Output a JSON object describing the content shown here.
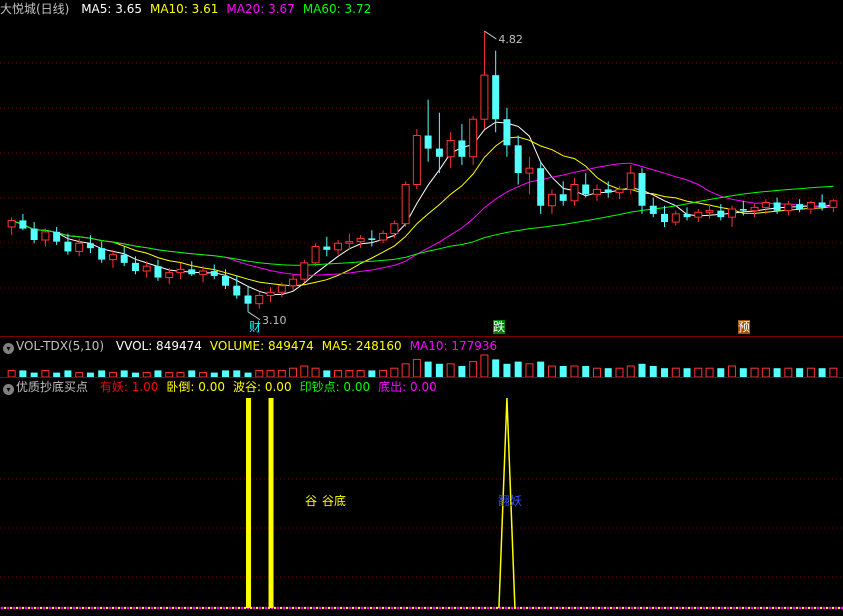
{
  "main": {
    "title": "大悦城(日线)",
    "ma": [
      {
        "label": "MA5:",
        "value": "3.65",
        "color": "#ffffff"
      },
      {
        "label": "MA10:",
        "value": "3.61",
        "color": "#ffff00"
      },
      {
        "label": "MA20:",
        "value": "3.67",
        "color": "#ff00ff"
      },
      {
        "label": "MA60:",
        "value": "3.72",
        "color": "#00ff00"
      }
    ],
    "high_label": "4.82",
    "low_label": "3.10",
    "markers": [
      {
        "text": "财",
        "color": "#00ffff",
        "bg": "#202080"
      },
      {
        "text": "跌",
        "color": "#ffffff",
        "bg": "#008000"
      },
      {
        "text": "预",
        "color": "#ffffff",
        "bg": "#a05000"
      }
    ]
  },
  "volume": {
    "title": "VOL-TDX(5,10)",
    "items": [
      {
        "label": "VVOL:",
        "value": "849474",
        "color": "#ffffff"
      },
      {
        "label": "VOLUME:",
        "value": "849474",
        "color": "#ffff00"
      },
      {
        "label": "MA5:",
        "value": "248160",
        "color": "#ffff00"
      },
      {
        "label": "MA10:",
        "value": "177936",
        "color": "#ff00ff"
      }
    ]
  },
  "indicator": {
    "title": "优质抄底买点",
    "items": [
      {
        "label": "有妖:",
        "value": "1.00",
        "color": "#ff0000"
      },
      {
        "label": "卧倒:",
        "value": "0.00",
        "color": "#ffff00"
      },
      {
        "label": "波谷:",
        "value": "0.00",
        "color": "#ffff00"
      },
      {
        "label": "印钞点:",
        "value": "0.00",
        "color": "#00ff00"
      },
      {
        "label": "底出:",
        "value": "0.00",
        "color": "#ff00ff"
      }
    ],
    "labels": [
      {
        "text": "谷",
        "color": "#ffff00"
      },
      {
        "text": "谷底",
        "color": "#ffff00"
      },
      {
        "text": "翻妖",
        "color": "#0000ff"
      }
    ]
  },
  "chart_data": {
    "type": "candlestick",
    "candles": [
      [
        3.62,
        3.68,
        3.57,
        3.66
      ],
      [
        3.66,
        3.7,
        3.6,
        3.61
      ],
      [
        3.61,
        3.65,
        3.52,
        3.54
      ],
      [
        3.54,
        3.61,
        3.5,
        3.59
      ],
      [
        3.59,
        3.62,
        3.51,
        3.53
      ],
      [
        3.53,
        3.58,
        3.45,
        3.47
      ],
      [
        3.47,
        3.55,
        3.44,
        3.52
      ],
      [
        3.52,
        3.57,
        3.46,
        3.49
      ],
      [
        3.49,
        3.53,
        3.4,
        3.42
      ],
      [
        3.42,
        3.48,
        3.37,
        3.45
      ],
      [
        3.45,
        3.5,
        3.38,
        3.4
      ],
      [
        3.4,
        3.44,
        3.33,
        3.35
      ],
      [
        3.35,
        3.41,
        3.31,
        3.38
      ],
      [
        3.38,
        3.42,
        3.29,
        3.31
      ],
      [
        3.31,
        3.37,
        3.27,
        3.34
      ],
      [
        3.34,
        3.4,
        3.3,
        3.36
      ],
      [
        3.36,
        3.41,
        3.32,
        3.33
      ],
      [
        3.33,
        3.38,
        3.28,
        3.35
      ],
      [
        3.35,
        3.39,
        3.3,
        3.32
      ],
      [
        3.32,
        3.36,
        3.24,
        3.26
      ],
      [
        3.26,
        3.32,
        3.18,
        3.2
      ],
      [
        3.2,
        3.26,
        3.1,
        3.15
      ],
      [
        3.15,
        3.22,
        3.12,
        3.2
      ],
      [
        3.2,
        3.25,
        3.16,
        3.22
      ],
      [
        3.22,
        3.28,
        3.19,
        3.26
      ],
      [
        3.26,
        3.33,
        3.23,
        3.3
      ],
      [
        3.3,
        3.42,
        3.28,
        3.4
      ],
      [
        3.4,
        3.52,
        3.38,
        3.5
      ],
      [
        3.5,
        3.56,
        3.44,
        3.48
      ],
      [
        3.48,
        3.54,
        3.45,
        3.52
      ],
      [
        3.52,
        3.58,
        3.48,
        3.53
      ],
      [
        3.53,
        3.57,
        3.49,
        3.55
      ],
      [
        3.55,
        3.6,
        3.5,
        3.54
      ],
      [
        3.54,
        3.6,
        3.52,
        3.58
      ],
      [
        3.58,
        3.66,
        3.55,
        3.64
      ],
      [
        3.64,
        3.9,
        3.62,
        3.88
      ],
      [
        3.88,
        4.22,
        3.85,
        4.18
      ],
      [
        4.18,
        4.4,
        4.02,
        4.1
      ],
      [
        4.1,
        4.32,
        3.95,
        4.05
      ],
      [
        4.05,
        4.2,
        3.98,
        4.15
      ],
      [
        4.15,
        4.25,
        4.0,
        4.05
      ],
      [
        4.05,
        4.3,
        4.0,
        4.28
      ],
      [
        4.28,
        4.82,
        4.22,
        4.55
      ],
      [
        4.55,
        4.7,
        4.2,
        4.28
      ],
      [
        4.28,
        4.35,
        4.05,
        4.12
      ],
      [
        4.12,
        4.18,
        3.88,
        3.95
      ],
      [
        3.95,
        4.05,
        3.82,
        3.98
      ],
      [
        3.98,
        4.02,
        3.7,
        3.75
      ],
      [
        3.75,
        3.85,
        3.7,
        3.82
      ],
      [
        3.82,
        3.9,
        3.75,
        3.78
      ],
      [
        3.78,
        3.92,
        3.75,
        3.88
      ],
      [
        3.88,
        3.95,
        3.8,
        3.82
      ],
      [
        3.82,
        3.88,
        3.78,
        3.85
      ],
      [
        3.85,
        3.9,
        3.8,
        3.83
      ],
      [
        3.83,
        3.87,
        3.79,
        3.85
      ],
      [
        3.85,
        4.0,
        3.82,
        3.95
      ],
      [
        3.95,
        3.98,
        3.7,
        3.75
      ],
      [
        3.75,
        3.8,
        3.68,
        3.7
      ],
      [
        3.7,
        3.75,
        3.62,
        3.65
      ],
      [
        3.65,
        3.72,
        3.63,
        3.7
      ],
      [
        3.7,
        3.74,
        3.66,
        3.68
      ],
      [
        3.68,
        3.73,
        3.65,
        3.71
      ],
      [
        3.71,
        3.76,
        3.67,
        3.72
      ],
      [
        3.72,
        3.76,
        3.66,
        3.68
      ],
      [
        3.68,
        3.75,
        3.62,
        3.73
      ],
      [
        3.73,
        3.78,
        3.69,
        3.72
      ],
      [
        3.72,
        3.76,
        3.68,
        3.74
      ],
      [
        3.74,
        3.79,
        3.7,
        3.77
      ],
      [
        3.77,
        3.8,
        3.7,
        3.72
      ],
      [
        3.72,
        3.78,
        3.69,
        3.76
      ],
      [
        3.76,
        3.79,
        3.71,
        3.73
      ],
      [
        3.73,
        3.78,
        3.7,
        3.77
      ],
      [
        3.77,
        3.82,
        3.72,
        3.74
      ],
      [
        3.74,
        3.79,
        3.71,
        3.78
      ]
    ],
    "volumes": [
      3,
      3,
      2,
      3,
      2,
      3,
      2,
      2,
      3,
      2,
      3,
      2,
      2,
      3,
      2,
      2,
      3,
      2,
      2,
      3,
      3,
      2,
      3,
      3,
      3,
      4,
      5,
      4,
      3,
      3,
      3,
      3,
      3,
      3,
      4,
      6,
      8,
      7,
      6,
      6,
      5,
      7,
      10,
      8,
      6,
      7,
      6,
      7,
      5,
      5,
      5,
      5,
      4,
      4,
      4,
      5,
      6,
      5,
      4,
      4,
      4,
      4,
      4,
      4,
      5,
      4,
      4,
      4,
      4,
      4,
      4,
      4,
      4,
      4
    ],
    "indicator_spikes": [
      {
        "index": 21,
        "value": 1.0,
        "color": "#ffff00"
      },
      {
        "index": 23,
        "value": 1.0,
        "color": "#ffff00"
      },
      {
        "index": 44,
        "value": 1.0,
        "color": "#ffff00",
        "shape": "triangle"
      }
    ]
  }
}
